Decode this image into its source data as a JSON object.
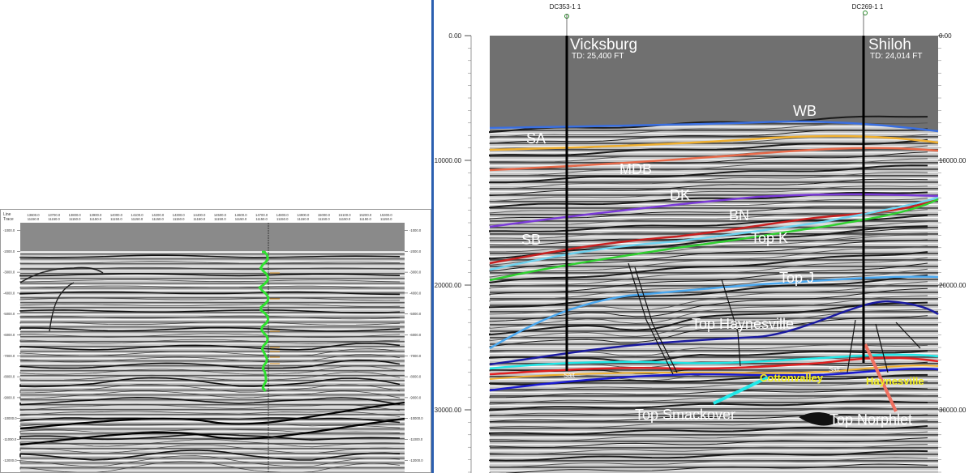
{
  "left_panel": {
    "header_labels": [
      "Line",
      "Trace"
    ],
    "line_values": [
      "13600.0",
      "13700.0",
      "13800.0",
      "13900.0",
      "14000.0",
      "14100.0",
      "14200.0",
      "14300.0",
      "14400.0",
      "14500.0",
      "14600.0",
      "14700.0",
      "14800.0",
      "14900.0",
      "15000.0",
      "15100.0",
      "15200.0",
      "15300.0"
    ],
    "trace_values": [
      "11150.0",
      "11150.0",
      "11150.0",
      "11150.0",
      "11150.0",
      "11150.0",
      "11150.0",
      "11150.0",
      "11150.0",
      "11150.0",
      "11150.0",
      "11150.0",
      "11150.0",
      "11150.0",
      "11150.0",
      "11150.0",
      "11150.0",
      "11150.0"
    ],
    "left_depth_ticks": [
      "-1000.0",
      "-2000.0",
      "-3000.0",
      "-4000.0",
      "-5000.0",
      "-6000.0",
      "-7000.0",
      "-8000.0",
      "-9000.0",
      "-10000.0",
      "-11000.0",
      "-12000.0"
    ],
    "right_depth_ticks": [
      "-1000.0",
      "-2000.0",
      "-3000.0",
      "-4000.0",
      "-5000.0",
      "-6000.0",
      "-7000.0",
      "-8000.0",
      "-9000.0",
      "-10000.0",
      "-11000.0",
      "-12000.0"
    ]
  },
  "right_panel": {
    "well_headers": [
      "DC353-1 1",
      "DC269-1 1"
    ],
    "wells": [
      {
        "name": "Vicksburg",
        "td": "TD: 25,400 FT"
      },
      {
        "name": "Shiloh",
        "td": "TD: 24,014 FT"
      }
    ],
    "depth_ticks_left": [
      "0.00",
      "10000.00",
      "20000.00",
      "30000.00"
    ],
    "depth_ticks_right": [
      "0.00",
      "10000.00",
      "20000.00",
      "30000.00"
    ],
    "horizon_labels": [
      {
        "text": "WB"
      },
      {
        "text": "SA"
      },
      {
        "text": "MDB"
      },
      {
        "text": "DK"
      },
      {
        "text": "BN"
      },
      {
        "text": "SB"
      },
      {
        "text": "Top K"
      },
      {
        "text": "Top J"
      },
      {
        "text": "Top Haynesville"
      },
      {
        "text": "Top Smackover"
      },
      {
        "text": "Top Norphlet"
      }
    ],
    "yellow_labels": [
      "Cottonvalley",
      "Haynesville"
    ],
    "salt_labels": [
      "Salt",
      "Salt"
    ]
  },
  "colors": {
    "divider": "#2b5fb0",
    "water_column": "#6f6f6f",
    "wb": "#3a6fe0",
    "sa": "#f0b030",
    "mdb": "#e86a4a",
    "dk": "#7a3ad8",
    "bn": "#6fd3f0",
    "sb": "#c82020",
    "top_k": "#30d030",
    "top_j": "#4aa8f0",
    "top_haynesville": "#1a1aa0",
    "cyan": "#20e8e8",
    "well_log": "#30e030"
  }
}
